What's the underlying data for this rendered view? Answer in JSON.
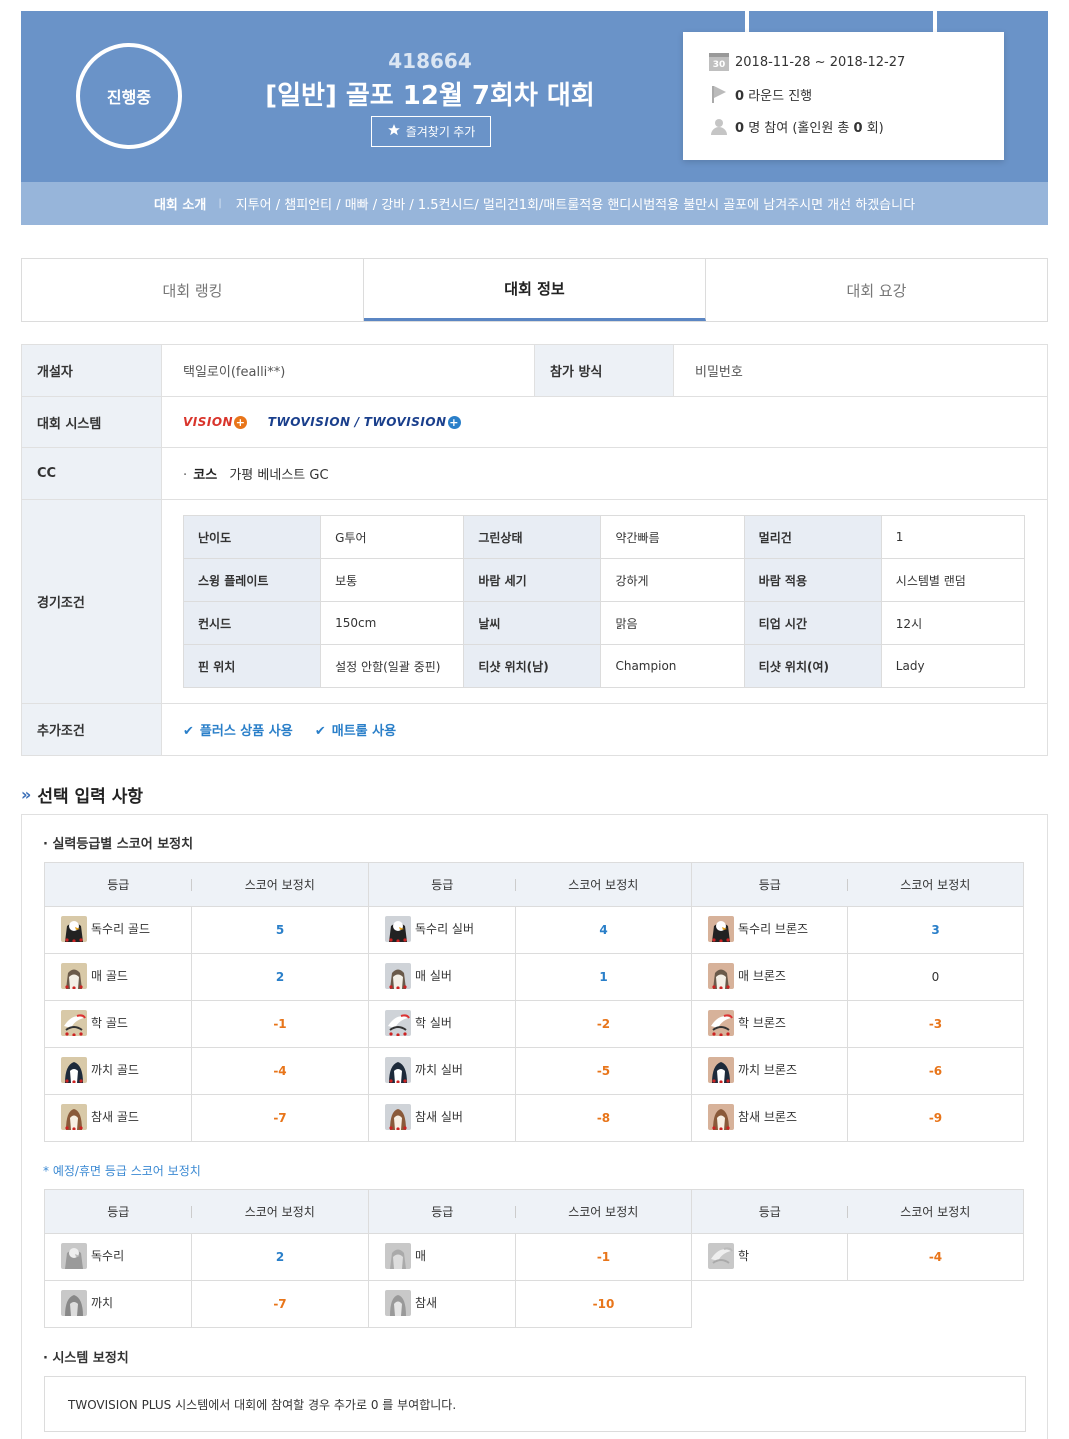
{
  "banner": {
    "status": "진행중",
    "id": "418664",
    "title": "[일반] 골포 12월 7회차 대회",
    "favorite_label": "즐겨찾기 추가",
    "calendar_day": "30",
    "period": "2018-11-28 ~ 2018-12-27",
    "rounds_count": "0",
    "rounds_label": "라운드 진행",
    "participants_count": "0",
    "participants_prefix": "명 참여 (홀인원 총",
    "holeinone_count": "0",
    "participants_suffix": "회)",
    "intro_label": "대회 소개",
    "intro_sep": "|",
    "intro_text": "지투어 / 챔피언티 / 매빠 / 강바 / 1.5컨시드/ 멀리건1회/매트룰적용 핸디시범적용 불만시 골포에 남겨주시면 개선 하겠습니다"
  },
  "tabs": [
    {
      "label": "대회 랭킹",
      "active": false
    },
    {
      "label": "대회 정보",
      "active": true
    },
    {
      "label": "대회 요강",
      "active": false
    }
  ],
  "info": {
    "creator_label": "개설자",
    "creator_value": "택일로이(fealli**)",
    "join_label": "참가 방식",
    "join_value": "비밀번호",
    "system_label": "대회 시스템",
    "system_logos": {
      "vision": "VISION",
      "two1": "TWOVISION",
      "slash": "/",
      "two2": "TWOVISION",
      "plus": "+"
    },
    "cc_label": "CC",
    "course_bullet": "·",
    "course_label": "코스",
    "course_value": "가평 베네스트 GC",
    "conditions_label": "경기조건",
    "conditions": [
      [
        [
          "난이도",
          "G투어"
        ],
        [
          "그린상태",
          "약간빠름"
        ],
        [
          "멀리건",
          "1"
        ]
      ],
      [
        [
          "스윙 플레이트",
          "보통"
        ],
        [
          "바람 세기",
          "강하게"
        ],
        [
          "바람 적용",
          "시스템별 랜덤"
        ]
      ],
      [
        [
          "컨시드",
          "150cm"
        ],
        [
          "날씨",
          "맑음"
        ],
        [
          "티업 시간",
          "12시"
        ]
      ],
      [
        [
          "핀 위치",
          "설정 안함(일괄 중핀)"
        ],
        [
          "티샷 위치(남)",
          "Champion"
        ],
        [
          "티샷 위치(여)",
          "Lady"
        ]
      ]
    ],
    "extra_label": "추가조건",
    "extra_items": [
      "플러스 상품 사용",
      "매트룰 사용"
    ]
  },
  "optional": {
    "title": "선택 입력 사항",
    "grade_title": "· 실력등급별 스코어 보정치",
    "col_grade": "등급",
    "col_score": "스코어 보정치",
    "grade_rows": [
      [
        {
          "name": "독수리 골드",
          "score": "5",
          "av": "eagle",
          "tier": "gold"
        },
        {
          "name": "독수리 실버",
          "score": "4",
          "av": "eagle",
          "tier": "silver"
        },
        {
          "name": "독수리 브론즈",
          "score": "3",
          "av": "eagle",
          "tier": "bronze"
        }
      ],
      [
        {
          "name": "매 골드",
          "score": "2",
          "av": "hawk",
          "tier": "gold"
        },
        {
          "name": "매 실버",
          "score": "1",
          "av": "hawk",
          "tier": "silver"
        },
        {
          "name": "매 브론즈",
          "score": "0",
          "av": "hawk",
          "tier": "bronze"
        }
      ],
      [
        {
          "name": "학 골드",
          "score": "-1",
          "av": "crane",
          "tier": "gold"
        },
        {
          "name": "학 실버",
          "score": "-2",
          "av": "crane",
          "tier": "silver"
        },
        {
          "name": "학 브론즈",
          "score": "-3",
          "av": "crane",
          "tier": "bronze"
        }
      ],
      [
        {
          "name": "까치 골드",
          "score": "-4",
          "av": "magpie",
          "tier": "gold"
        },
        {
          "name": "까치 실버",
          "score": "-5",
          "av": "magpie",
          "tier": "silver"
        },
        {
          "name": "까치 브론즈",
          "score": "-6",
          "av": "magpie",
          "tier": "bronze"
        }
      ],
      [
        {
          "name": "참새 골드",
          "score": "-7",
          "av": "sparrow",
          "tier": "gold"
        },
        {
          "name": "참새 실버",
          "score": "-8",
          "av": "sparrow",
          "tier": "silver"
        },
        {
          "name": "참새 브론즈",
          "score": "-9",
          "av": "sparrow",
          "tier": "bronze"
        }
      ]
    ],
    "prelim_title": "* 예정/휴면 등급 스코어 보정치",
    "prelim_rows": [
      [
        {
          "name": "독수리",
          "score": "2",
          "av": "eagle"
        },
        {
          "name": "매",
          "score": "-1",
          "av": "hawk"
        },
        {
          "name": "학",
          "score": "-4",
          "av": "crane"
        }
      ],
      [
        {
          "name": "까치",
          "score": "-7",
          "av": "magpie"
        },
        {
          "name": "참새",
          "score": "-10",
          "av": "sparrow"
        }
      ]
    ],
    "system_title": "· 시스템 보정치",
    "system_text": "TWOVISION PLUS 시스템에서 대회에 참여할 경우 추가로 0 를 부여합니다."
  },
  "colors": {
    "banner": "#6a93c8",
    "intro_bar": "#97b5da",
    "positive": "#2a7fc9",
    "negative": "#e8751a",
    "tab_active": "#5b86c3"
  }
}
